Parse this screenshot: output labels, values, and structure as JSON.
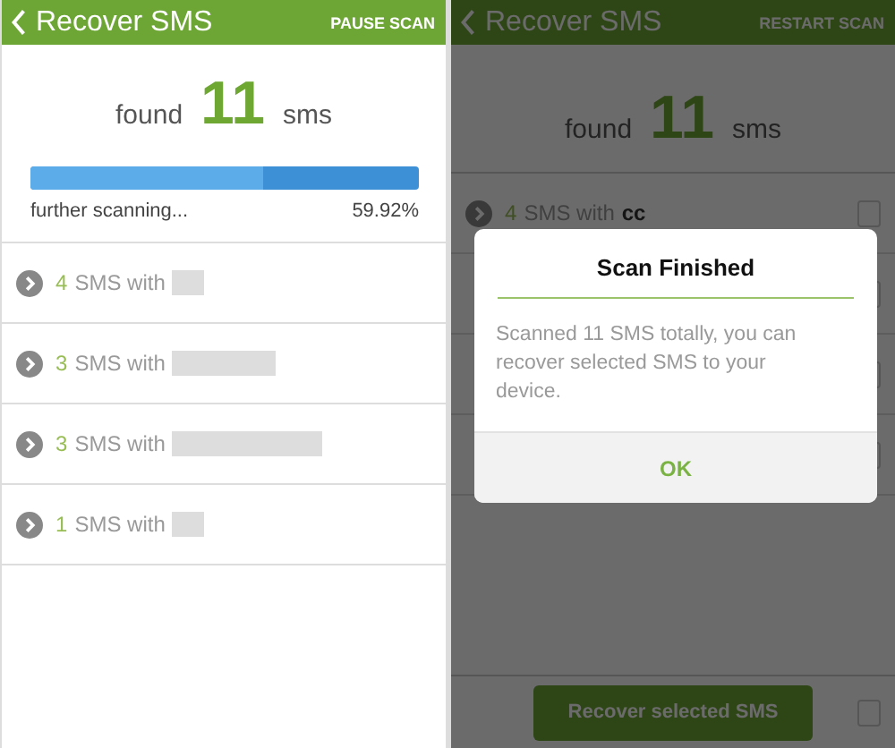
{
  "scan_screen": {
    "header": {
      "title": "Recover SMS",
      "action": "PAUSE SCAN"
    },
    "summary": {
      "label": "found",
      "count": "11",
      "unit": "sms"
    },
    "progress": {
      "level": 0.5992,
      "status": "further scanning...",
      "percent": "59.92%"
    },
    "rows": [
      {
        "count": "4",
        "label": "SMS with"
      },
      {
        "count": "3",
        "label": "SMS with"
      },
      {
        "count": "3",
        "label": "SMS with"
      },
      {
        "count": "1",
        "label": "SMS with"
      }
    ]
  },
  "result_screen": {
    "header": {
      "title": "Recover SMS",
      "action": "RESTART SCAN"
    },
    "summary": {
      "label": "found",
      "count": "11",
      "unit": "sms"
    },
    "rows": [
      {
        "count": "4",
        "label": "SMS with",
        "contact": "cc",
        "checked": false
      },
      {
        "checked": false
      },
      {
        "checked": false
      },
      {
        "checked": false
      }
    ],
    "dialog": {
      "title": "Scan Finished",
      "message": "Scanned 11 SMS totally, you can recover selected SMS to your device.",
      "button": "OK"
    },
    "footer": {
      "button": "Recover selected SMS",
      "checked": false
    }
  }
}
